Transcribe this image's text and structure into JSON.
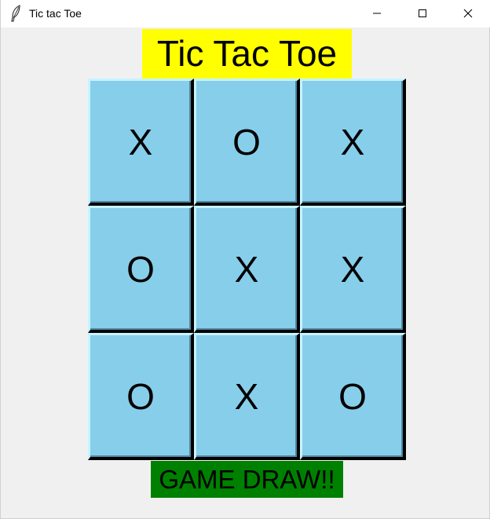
{
  "window": {
    "title": "Tic tac Toe",
    "icon": "feather-icon",
    "controls": [
      "minimize-icon",
      "maximize-icon",
      "close-icon"
    ]
  },
  "heading": "Tic Tac Toe",
  "board": [
    [
      "X",
      "O",
      "X"
    ],
    [
      "O",
      "X",
      "X"
    ],
    [
      "O",
      "X",
      "O"
    ]
  ],
  "status": "GAME DRAW!!",
  "colors": {
    "heading_bg": "#ffff00",
    "cell_bg": "#87ceeb",
    "status_bg": "#008000"
  }
}
